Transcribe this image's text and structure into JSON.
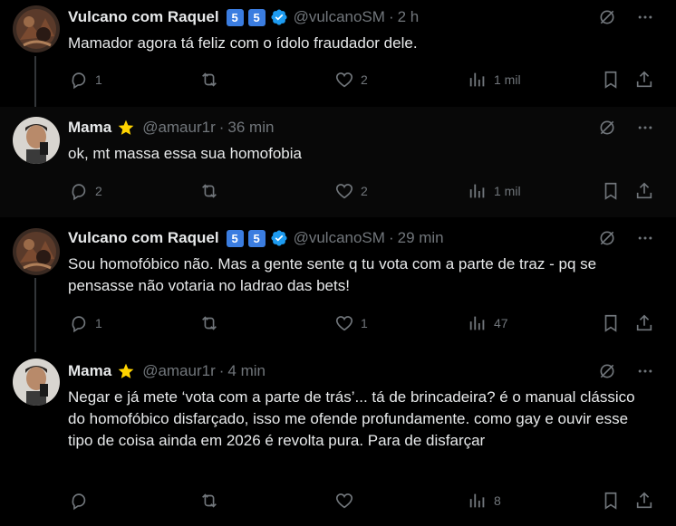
{
  "tweets": [
    {
      "name": "Vulcano com Raquel",
      "badges": [
        "5",
        "5"
      ],
      "handle": "@vulcanoSM",
      "time": "2 h",
      "text": "Mamador agora tá feliz com o ídolo fraudador dele.",
      "replies": "1",
      "retweets": "",
      "likes": "2",
      "views": "1 mil"
    },
    {
      "name": "Mama",
      "handle": "@amaur1r",
      "time": "36 min",
      "text": "ok, mt massa essa sua homofobia",
      "replies": "2",
      "retweets": "",
      "likes": "2",
      "views": "1 mil"
    },
    {
      "name": "Vulcano com Raquel",
      "badges": [
        "5",
        "5"
      ],
      "handle": "@vulcanoSM",
      "time": "29 min",
      "text": "Sou homofóbico não. Mas a gente sente q tu vota com a parte de traz - pq se pensasse não votaria no ladrao das bets!",
      "replies": "1",
      "retweets": "",
      "likes": "1",
      "views": "47"
    },
    {
      "name": "Mama",
      "handle": "@amaur1r",
      "time": "4 min",
      "text": "Negar e já mete ‘vota com a parte de trás’... tá de brincadeira? é o manual clássico do homofóbico disfarçado, isso me ofende profundamente. como gay e ouvir esse tipo de coisa ainda em 2026 é revolta pura. Para de disfarçar",
      "replies": "",
      "retweets": "",
      "likes": "",
      "views": "8"
    }
  ],
  "separator": "·",
  "colors": {
    "background": "#000000",
    "text": "#e7e9ea",
    "muted": "#71767b",
    "thread_line": "#333639",
    "verified": "#1d9bf0",
    "badge": "#3b7de0",
    "star": "#ffd400"
  },
  "icons": [
    "grok-icon",
    "more-icon",
    "reply-icon",
    "retweet-icon",
    "like-icon",
    "views-icon",
    "bookmark-icon",
    "share-icon",
    "verified-icon",
    "star-icon"
  ]
}
